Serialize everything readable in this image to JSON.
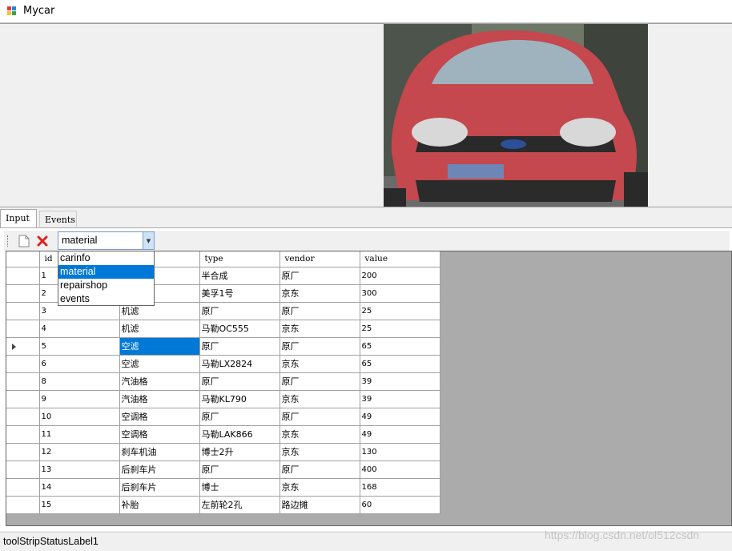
{
  "window": {
    "title": "Mycar"
  },
  "tabs": [
    {
      "label": "Input"
    },
    {
      "label": "Events"
    }
  ],
  "toolbar": {
    "new_icon": "new-document-icon",
    "delete_icon": "delete-x-icon",
    "combo_value": "material",
    "combo_options": [
      "carinfo",
      "material",
      "repairshop",
      "events"
    ]
  },
  "grid": {
    "columns": [
      "id",
      "",
      "type",
      "vendor",
      "value"
    ],
    "rows": [
      {
        "id": "1",
        "name": "",
        "type": "半合成",
        "vendor": "原厂",
        "value": "200"
      },
      {
        "id": "2",
        "name": "",
        "type": "美孚1号",
        "vendor": "京东",
        "value": "300"
      },
      {
        "id": "3",
        "name": "机滤",
        "type": "原厂",
        "vendor": "原厂",
        "value": "25"
      },
      {
        "id": "4",
        "name": "机滤",
        "type": "马勒OC555",
        "vendor": "京东",
        "value": "25"
      },
      {
        "id": "5",
        "name": "空滤",
        "type": "原厂",
        "vendor": "原厂",
        "value": "65"
      },
      {
        "id": "6",
        "name": "空滤",
        "type": "马勒LX2824",
        "vendor": "京东",
        "value": "65"
      },
      {
        "id": "8",
        "name": "汽油格",
        "type": "原厂",
        "vendor": "原厂",
        "value": "39"
      },
      {
        "id": "9",
        "name": "汽油格",
        "type": "马勒KL790",
        "vendor": "京东",
        "value": "39"
      },
      {
        "id": "10",
        "name": "空调格",
        "type": "原厂",
        "vendor": "原厂",
        "value": "49"
      },
      {
        "id": "11",
        "name": "空调格",
        "type": "马勒LAK866",
        "vendor": "京东",
        "value": "49"
      },
      {
        "id": "12",
        "name": "刹车机油",
        "type": "博士2升",
        "vendor": "京东",
        "value": "130"
      },
      {
        "id": "13",
        "name": "后刹车片",
        "type": "原厂",
        "vendor": "原厂",
        "value": "400"
      },
      {
        "id": "14",
        "name": "后刹车片",
        "type": "博士",
        "vendor": "京东",
        "value": "168"
      },
      {
        "id": "15",
        "name": "补胎",
        "type": "左前轮2孔",
        "vendor": "路边摊",
        "value": "60"
      }
    ]
  },
  "status": {
    "label": "toolStripStatusLabel1"
  },
  "watermark": "https://blog.csdn.net/ol512csdn",
  "colors": {
    "selection": "#0078d7",
    "grid_background": "#ababab"
  }
}
